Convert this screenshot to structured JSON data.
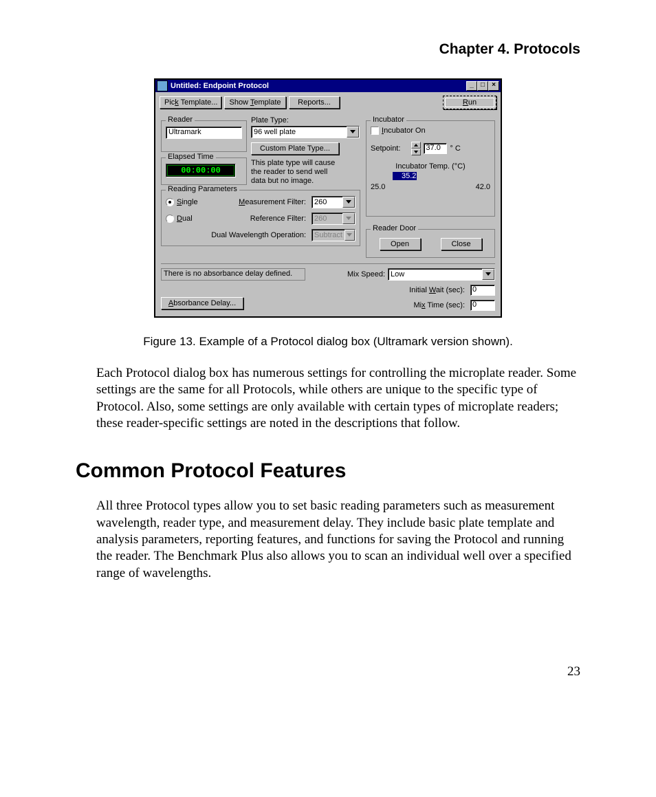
{
  "chapter_header": "Chapter 4.  Protocols",
  "dialog": {
    "title": "Untitled: Endpoint Protocol",
    "toolbar": {
      "pick_template": "Pick Template...",
      "show_template": "Show Template",
      "reports": "Reports...",
      "run": "Run"
    },
    "reader": {
      "legend": "Reader",
      "value": "Ultramark"
    },
    "elapsed": {
      "legend": "Elapsed Time",
      "value": "00:00:00"
    },
    "plate": {
      "label": "Plate Type:",
      "value": "96 well plate",
      "custom_btn": "Custom Plate Type...",
      "note": "This plate type will cause the reader to send well data but no image."
    },
    "reading": {
      "legend": "Reading Parameters",
      "single": "Single",
      "dual": "Dual",
      "meas_label": "Measurement Filter:",
      "meas_value": "260",
      "ref_label": "Reference Filter:",
      "ref_value": "260",
      "dualop_label": "Dual Wavelength Operation:",
      "dualop_value": "Subtract"
    },
    "incubator": {
      "legend": "Incubator",
      "checkbox": "Incubator On",
      "setpoint_label": "Setpoint:",
      "setpoint_value": "37.0",
      "setpoint_unit": "° C",
      "temp_label": "Incubator Temp. (°C)",
      "temp_value": "35.2",
      "temp_min": "25.0",
      "temp_max": "42.0"
    },
    "door": {
      "legend": "Reader Door",
      "open": "Open",
      "close": "Close"
    },
    "delay": {
      "status": "There is no absorbance delay defined.",
      "btn": "Absorbance Delay..."
    },
    "mix": {
      "speed_label": "Mix Speed:",
      "speed_value": "Low",
      "wait_label": "Initial Wait (sec):",
      "wait_value": "0",
      "time_label": "Mix Time (sec):",
      "time_value": "0"
    }
  },
  "figure_caption": "Figure 13.  Example of a Protocol dialog box (Ultramark version shown).",
  "para1": "Each Protocol dialog box has numerous settings for controlling the microplate reader. Some settings are the same for all Protocols, while others are unique to the specific type of Protocol. Also, some settings are only available with certain types of microplate readers; these reader-specific settings are noted in the descriptions that follow.",
  "section_heading": "Common Protocol Features",
  "para2": "All three Protocol types allow you to set basic reading parameters such as measurement wavelength, reader type, and measurement delay. They include basic plate template and analysis parameters, reporting features, and functions for saving the Protocol and running the reader. The Benchmark Plus also allows you to scan an individual well over a specified range of wavelengths.",
  "page_number": "23"
}
